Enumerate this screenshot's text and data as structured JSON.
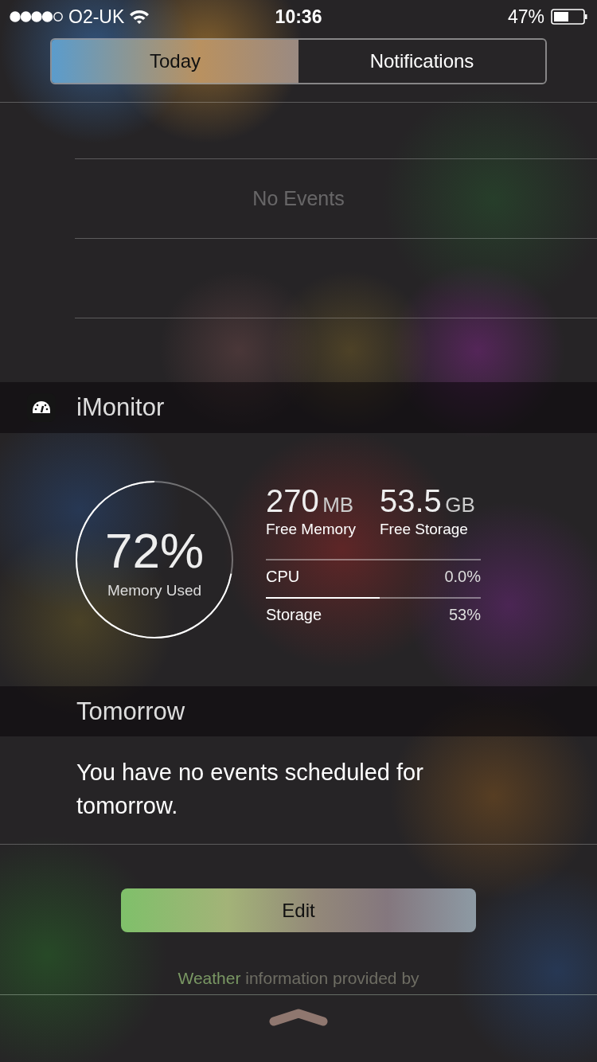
{
  "status_bar": {
    "carrier": "O2-UK",
    "time": "10:36",
    "battery": "47%"
  },
  "tabs": [
    {
      "label": "Today",
      "selected": true
    },
    {
      "label": "Notifications",
      "selected": false
    }
  ],
  "today": {
    "message": "No Events"
  },
  "imonitor": {
    "title": "iMonitor",
    "memory_used": {
      "value": "72%",
      "label": "Memory Used"
    },
    "stats": [
      {
        "value": "270",
        "unit": "MB",
        "label": "Free Memory"
      },
      {
        "value": "53.5",
        "unit": "GB",
        "label": "Free Storage"
      }
    ],
    "meters": [
      {
        "label": "CPU",
        "reading": "0.0%"
      },
      {
        "label": "Storage",
        "reading": "53%",
        "level": 0.53
      }
    ]
  },
  "tomorrow": {
    "title": "Tomorrow",
    "message": "You have no events scheduled for tomorrow."
  },
  "edit_button": "Edit",
  "footer": {
    "link": "Weather",
    "text": "information provided by"
  }
}
